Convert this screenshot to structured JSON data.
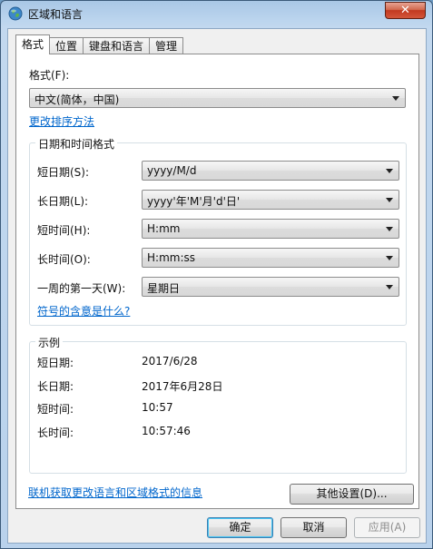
{
  "window": {
    "title": "区域和语言",
    "close_glyph": "✕"
  },
  "tabs": [
    {
      "label": "格式",
      "active": true
    },
    {
      "label": "位置",
      "active": false
    },
    {
      "label": "键盘和语言",
      "active": false
    },
    {
      "label": "管理",
      "active": false
    }
  ],
  "format": {
    "label": "格式(F):",
    "value": "中文(简体，中国)",
    "change_sort_link": "更改排序方法"
  },
  "datetime_group": {
    "title": "日期和时间格式",
    "rows": [
      {
        "label": "短日期(S):",
        "value": "yyyy/M/d"
      },
      {
        "label": "长日期(L):",
        "value": "yyyy'年'M'月'd'日'"
      },
      {
        "label": "短时间(H):",
        "value": "H:mm"
      },
      {
        "label": "长时间(O):",
        "value": "H:mm:ss"
      },
      {
        "label": "一周的第一天(W):",
        "value": "星期日"
      }
    ],
    "symbols_link": "符号的含意是什么?"
  },
  "examples_group": {
    "title": "示例",
    "rows": [
      {
        "label": "短日期:",
        "value": "2017/6/28"
      },
      {
        "label": "长日期:",
        "value": "2017年6月28日"
      },
      {
        "label": "短时间:",
        "value": "10:57"
      },
      {
        "label": "长时间:",
        "value": "10:57:46"
      }
    ]
  },
  "other_settings_button": "其他设置(D)...",
  "online_link": "联机获取更改语言和区域格式的信息",
  "dialog_buttons": {
    "ok": "确定",
    "cancel": "取消",
    "apply": "应用(A)"
  }
}
